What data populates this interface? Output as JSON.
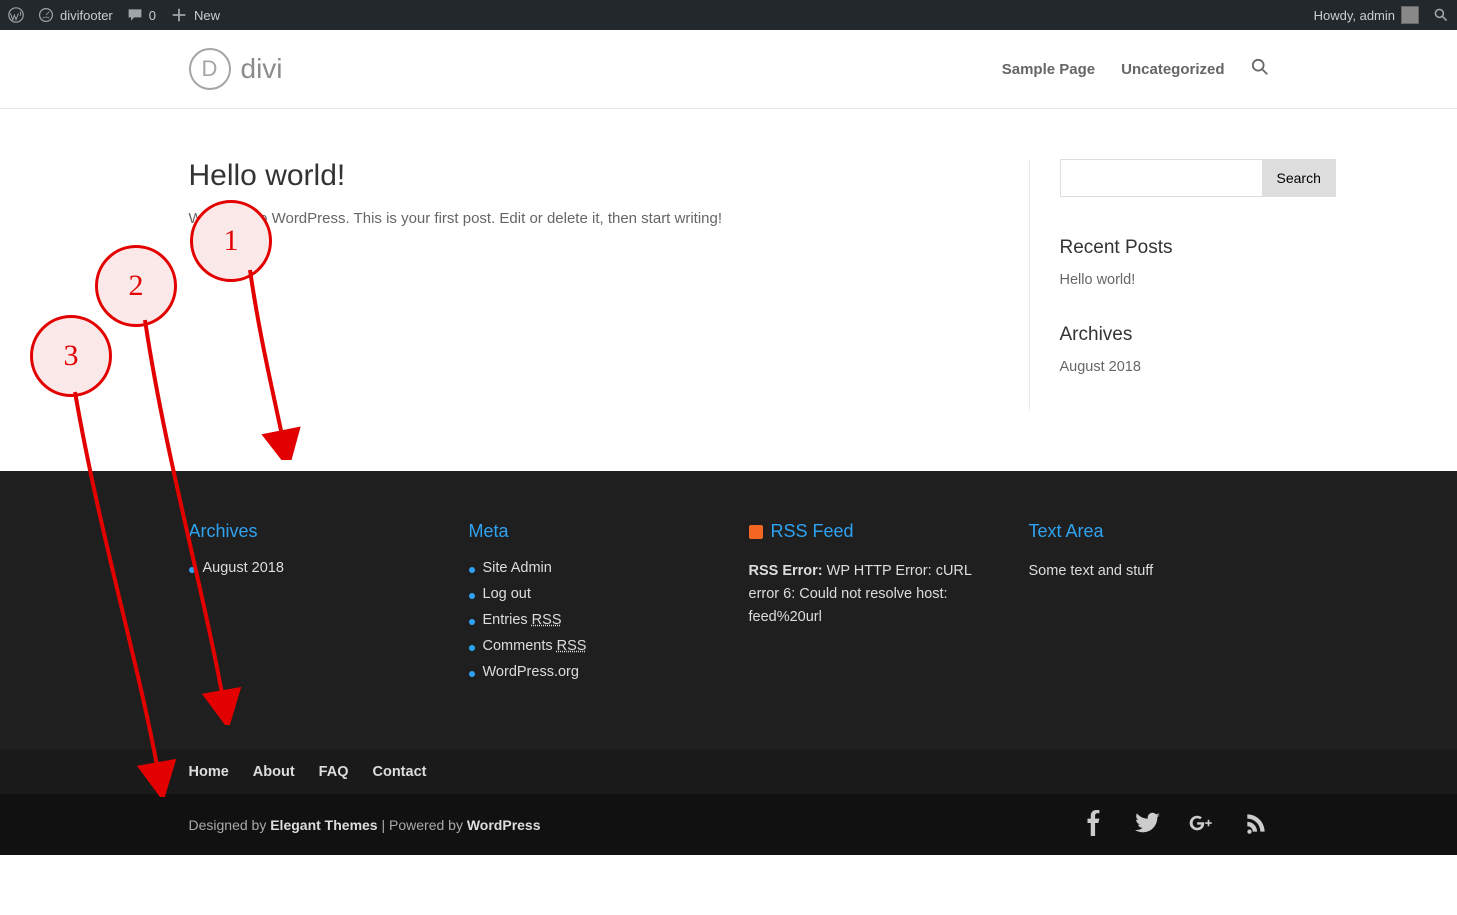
{
  "adminbar": {
    "site_name": "divifooter",
    "comments_count": "0",
    "new_label": "New",
    "howdy": "Howdy, admin"
  },
  "header": {
    "logo_text": "divi",
    "nav": [
      {
        "id": "sample-page",
        "label": "Sample Page"
      },
      {
        "id": "uncategorized",
        "label": "Uncategorized"
      }
    ]
  },
  "post": {
    "title": "Hello world!",
    "body": "Welcome to WordPress. This is your first post. Edit or delete it, then start writing!"
  },
  "sidebar": {
    "search_button": "Search",
    "recent_posts": {
      "title": "Recent Posts",
      "items": [
        "Hello world!"
      ]
    },
    "archives": {
      "title": "Archives",
      "items": [
        "August 2018"
      ]
    }
  },
  "footer_widgets": {
    "archives": {
      "title": "Archives",
      "items": [
        "August 2018"
      ]
    },
    "meta": {
      "title": "Meta",
      "items": [
        {
          "label": "Site Admin"
        },
        {
          "label": "Log out"
        },
        {
          "label_prefix": "Entries ",
          "rss": "RSS"
        },
        {
          "label_prefix": "Comments ",
          "rss": "RSS"
        },
        {
          "label": "WordPress.org"
        }
      ]
    },
    "rss_feed": {
      "title": "RSS Feed",
      "error_label": "RSS Error:",
      "error_text": " WP HTTP Error: cURL error 6: Could not resolve host: feed%20url"
    },
    "text_area": {
      "title": "Text Area",
      "body": "Some text and stuff"
    }
  },
  "footer_nav": [
    "Home",
    "About",
    "FAQ",
    "Contact"
  ],
  "credits": {
    "designed_by": "Designed by ",
    "elegant": "Elegant Themes",
    "mid": " | Powered by ",
    "wp": "WordPress"
  },
  "annotations": {
    "a1": "1",
    "a2": "2",
    "a3": "3"
  }
}
